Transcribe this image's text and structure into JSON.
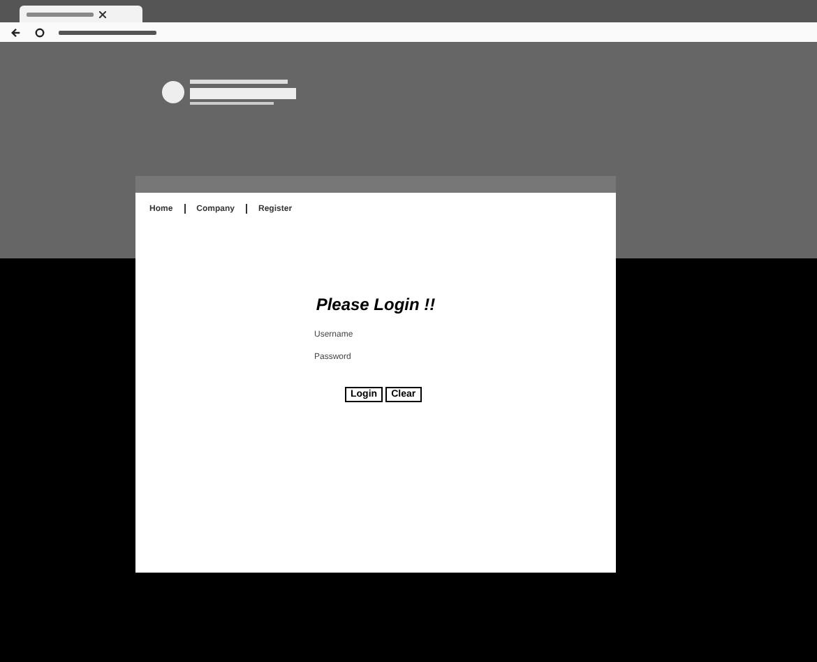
{
  "nav": [
    {
      "label": "Home"
    },
    {
      "label": "Company"
    },
    {
      "label": "Register"
    }
  ],
  "login": {
    "title": "Please Login !!",
    "fields": [
      {
        "label": "Username"
      },
      {
        "label": "Password"
      }
    ],
    "buttons": [
      "Login",
      "Clear"
    ]
  }
}
